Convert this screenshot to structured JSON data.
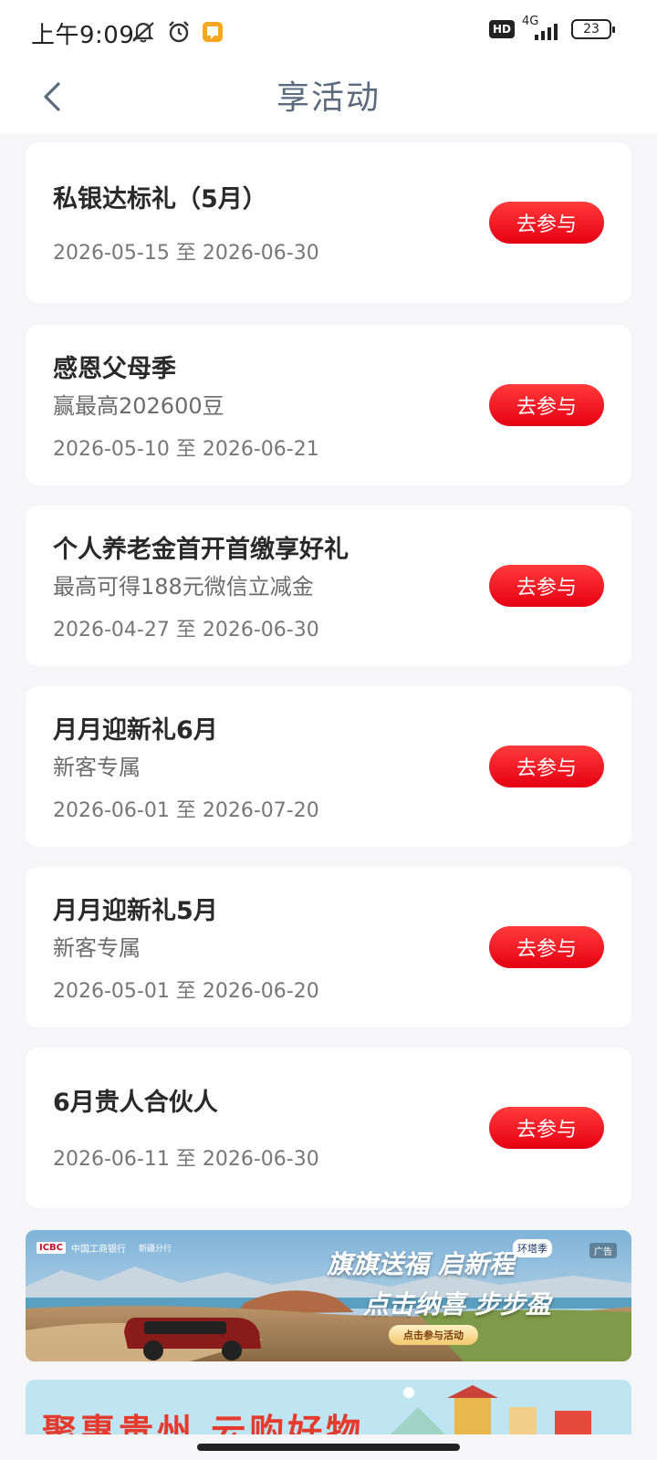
{
  "status_bar": {
    "time": "上午9:09",
    "network": "4G",
    "hd": "HD",
    "battery": "23"
  },
  "header": {
    "title": "享活动"
  },
  "activities": [
    {
      "title": "私银达标礼（5月）",
      "subtitle": "",
      "date": "2026-05-15 至 2026-06-30",
      "button": "去参与"
    },
    {
      "title": "感恩父母季",
      "subtitle": "赢最高202600豆",
      "date": "2026-05-10 至 2026-06-21",
      "button": "去参与"
    },
    {
      "title": "个人养老金首开首缴享好礼",
      "subtitle": "最高可得188元微信立减金",
      "date": "2026-04-27 至 2026-06-30",
      "button": "去参与"
    },
    {
      "title": "月月迎新礼6月",
      "subtitle": "新客专属",
      "date": "2026-06-01 至 2026-07-20",
      "button": "去参与"
    },
    {
      "title": "月月迎新礼5月",
      "subtitle": "新客专属",
      "date": "2026-05-01 至 2026-06-20",
      "button": "去参与"
    },
    {
      "title": "6月贵人合伙人",
      "subtitle": "",
      "date": "2026-06-11 至 2026-06-30",
      "button": "去参与"
    }
  ],
  "banner": {
    "bank_name": "中国工商银行",
    "bank_short": "ICBC",
    "branch": "新疆分行",
    "headline_1": "旗旗送福 启新程",
    "headline_2": "点击纳喜 步步盈",
    "tag": "环塔季",
    "ad_label": "广告",
    "cta": "点击参与活动"
  },
  "banner2": {
    "headline": "聚惠贵州 云购好物"
  },
  "colors": {
    "accent": "#e60012",
    "title_color": "#5b6b7d",
    "background": "#f6f6f8"
  }
}
